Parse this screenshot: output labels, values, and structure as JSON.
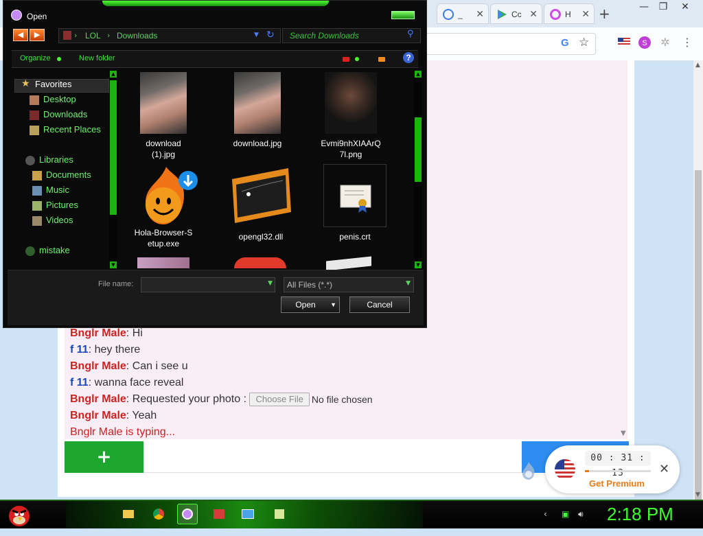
{
  "browser": {
    "tabs": [
      {
        "title": "_",
        "color": "#3c7be0"
      },
      {
        "title": "Cc",
        "color": "#34a853"
      },
      {
        "title": "H",
        "color": "#d24be8"
      }
    ],
    "window_controls": {
      "minimize": "—",
      "restore": "❐",
      "close": "✕"
    },
    "new_tab": "+",
    "toolbar_icons": {
      "google": "G",
      "bookmark": "☆",
      "menu": "⋮"
    }
  },
  "dialog": {
    "title": "Open",
    "breadcrumb": {
      "root": "LOL",
      "folder": "Downloads"
    },
    "search_placeholder": "Search Downloads",
    "commands": {
      "organize": "Organize",
      "new_folder": "New folder",
      "help": "?"
    },
    "nav": {
      "favorites": "Favorites",
      "favorite_items": [
        "Desktop",
        "Downloads",
        "Recent Places"
      ],
      "libraries": "Libraries",
      "library_items": [
        "Documents",
        "Music",
        "Pictures",
        "Videos"
      ],
      "other": "mistake"
    },
    "files": [
      {
        "name": "download\n(1).jpg",
        "kind": "photo-skin"
      },
      {
        "name": "download.jpg",
        "kind": "photo-skin"
      },
      {
        "name": "Evmi9nhXIAArQ\n7l.png",
        "kind": "photo-portrait"
      },
      {
        "name": "Hola-Browser-S\netup.exe",
        "kind": "hola-icon"
      },
      {
        "name": "opengl32.dll",
        "kind": "dll-icon"
      },
      {
        "name": "penis.crt",
        "kind": "certificate-icon"
      }
    ],
    "file_name_label": "File name:",
    "file_name_value": "",
    "file_type": "All Files (*.*)",
    "open_label": "Open",
    "cancel_label": "Cancel"
  },
  "chat": {
    "messages": [
      {
        "user": "Bnglr Male",
        "role": "stranger",
        "text": ": Hi"
      },
      {
        "user": "f 11",
        "role": "you",
        "text": ": hey there"
      },
      {
        "user": "Bnglr Male",
        "role": "stranger",
        "text": ": Can i see u"
      },
      {
        "user": "f 11",
        "role": "you",
        "text": ": wanna face reveal"
      },
      {
        "user": "Bnglr Male",
        "role": "stranger",
        "text": ": Requested your photo : "
      },
      {
        "user": "Bnglr Male",
        "role": "stranger",
        "text": ": Yeah"
      }
    ],
    "choose_file_label": "Choose File",
    "no_file_label": "No file chosen",
    "typing": "Bnglr Male is typing...",
    "plus_label": "+"
  },
  "premium": {
    "timer": "00 : 31 : 13",
    "progress": 0.06,
    "cta": "Get Premium",
    "close": "✕"
  },
  "taskbar": {
    "clock": "2:18 PM",
    "apps": [
      "folder",
      "chrome",
      "hola",
      "media",
      "display",
      "notes"
    ]
  },
  "colors": {
    "stranger": "#cc2222",
    "you": "#1a47b8",
    "accent_green": "#1ea72e",
    "neon": "#40ff30",
    "premium_orange": "#e97c1a"
  }
}
